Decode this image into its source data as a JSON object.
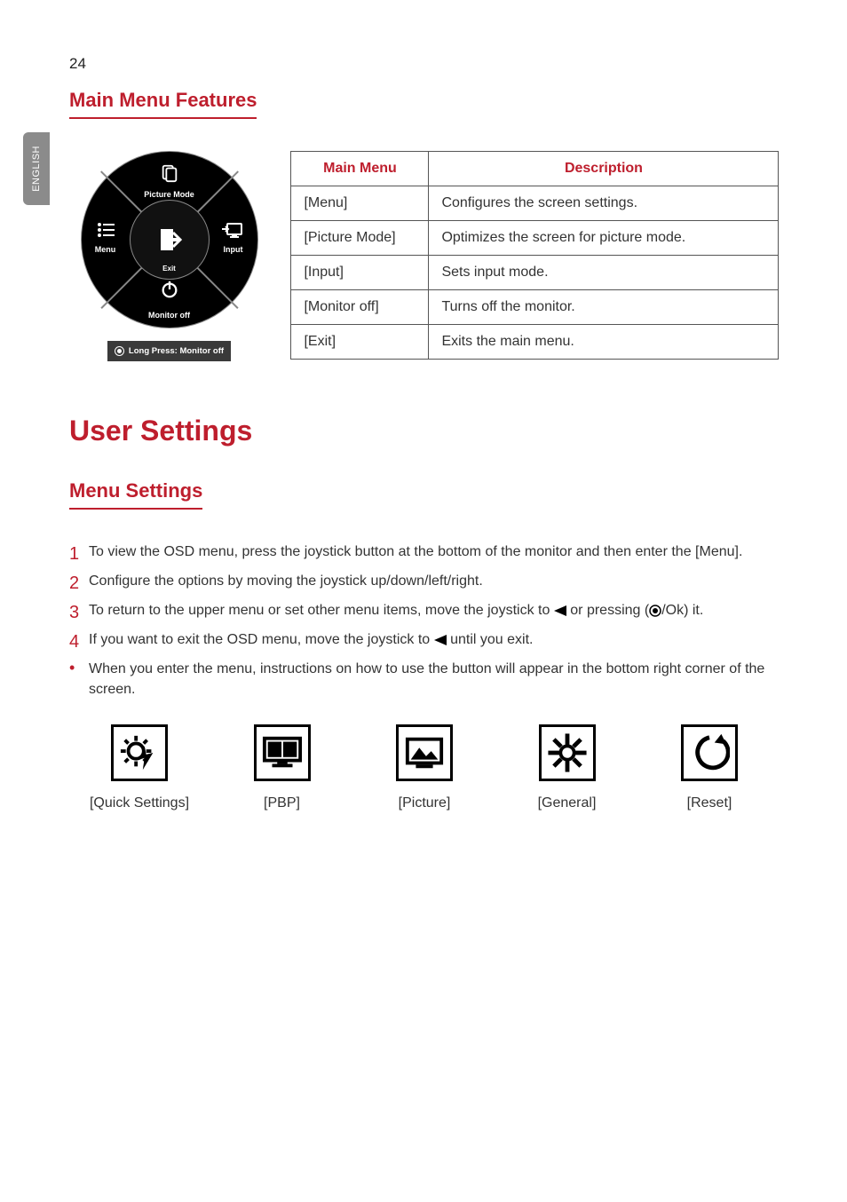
{
  "page_number": "24",
  "side_tab": "ENGLISH",
  "section1_title": "Main Menu Features",
  "joystick": {
    "top": "Picture Mode",
    "left": "Menu",
    "right": "Input",
    "center_below": "Exit",
    "bottom": "Monitor off",
    "longpress": "Long Press: Monitor off"
  },
  "table": {
    "head1": "Main Menu",
    "head2": "Description",
    "rows": [
      {
        "m": "[Menu]",
        "d": "Configures the screen settings."
      },
      {
        "m": "[Picture Mode]",
        "d": "Optimizes the screen for picture mode."
      },
      {
        "m": "[Input]",
        "d": "Sets input mode."
      },
      {
        "m": "[Monitor off]",
        "d": "Turns off the monitor."
      },
      {
        "m": "[Exit]",
        "d": "Exits the main menu."
      }
    ]
  },
  "section2_title": "User Settings",
  "section3_title": "Menu Settings",
  "steps": {
    "s1": "To view the OSD menu, press the joystick button at the bottom of the monitor and then enter the [Menu].",
    "s2": "Configure the options by moving the joystick up/down/left/right.",
    "s3a": "To return to the upper menu or set other menu items, move the joystick to ",
    "s3b": " or pressing (",
    "s3c": "/Ok) it.",
    "s4a": "If you want to exit the OSD menu, move the joystick to ",
    "s4b": " until you exit.",
    "bullet": "When you enter the menu, instructions on how to use the button will appear in the bottom right corner of the screen."
  },
  "osd": [
    "[Quick Settings]",
    "[PBP]",
    "[Picture]",
    "[General]",
    "[Reset]"
  ]
}
